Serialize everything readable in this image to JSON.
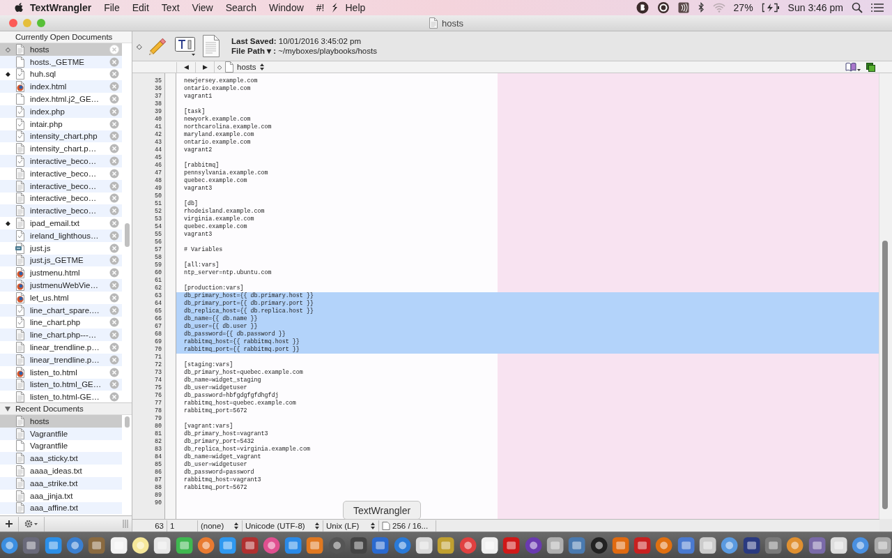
{
  "menubar": {
    "app": "TextWrangler",
    "menus": [
      "File",
      "Edit",
      "Text",
      "View",
      "Search",
      "Window",
      "#!"
    ],
    "help_menu": "Help",
    "battery": "27%",
    "clock": "Sun 3:46 pm"
  },
  "window": {
    "title": "hosts"
  },
  "sidebar": {
    "open_documents": {
      "title": "Currently Open Documents",
      "items": [
        {
          "name": "hosts",
          "kind": "text",
          "mark": "◇",
          "selected": true
        },
        {
          "name": "hosts._GETME",
          "kind": "blank",
          "selected": false
        },
        {
          "name": "huh.sql",
          "kind": "script",
          "mark": "◆",
          "selected": false
        },
        {
          "name": "index.html",
          "kind": "html",
          "selected": false
        },
        {
          "name": "index.html.j2_GE…",
          "kind": "blank",
          "selected": false
        },
        {
          "name": "index.php",
          "kind": "script",
          "selected": false
        },
        {
          "name": "intair.php",
          "kind": "script",
          "selected": false
        },
        {
          "name": "intensity_chart.php",
          "kind": "script",
          "selected": false
        },
        {
          "name": "intensity_chart.p…",
          "kind": "text",
          "selected": false
        },
        {
          "name": "interactive_beco…",
          "kind": "script",
          "selected": false
        },
        {
          "name": "interactive_beco…",
          "kind": "text",
          "selected": false
        },
        {
          "name": "interactive_beco…",
          "kind": "text",
          "selected": false
        },
        {
          "name": "interactive_beco…",
          "kind": "text",
          "selected": false
        },
        {
          "name": "interactive_beco…",
          "kind": "text",
          "selected": false
        },
        {
          "name": "ipad_email.txt",
          "kind": "text",
          "mark": "◆",
          "selected": false
        },
        {
          "name": "ireland_lighthous…",
          "kind": "script",
          "selected": false
        },
        {
          "name": "just.js",
          "kind": "js",
          "selected": false
        },
        {
          "name": "just.js_GETME",
          "kind": "text",
          "selected": false
        },
        {
          "name": "justmenu.html",
          "kind": "html",
          "selected": false
        },
        {
          "name": "justmenuWebVie…",
          "kind": "html",
          "selected": false
        },
        {
          "name": "let_us.html",
          "kind": "html",
          "selected": false
        },
        {
          "name": "line_chart_spare.…",
          "kind": "script",
          "selected": false
        },
        {
          "name": "line_chart.php",
          "kind": "script",
          "selected": false
        },
        {
          "name": "line_chart.php---…",
          "kind": "text",
          "selected": false
        },
        {
          "name": "linear_trendline.p…",
          "kind": "text",
          "selected": false
        },
        {
          "name": "linear_trendline.p…",
          "kind": "text",
          "selected": false
        },
        {
          "name": "listen_to.html",
          "kind": "html",
          "selected": false
        },
        {
          "name": "listen_to.html_GE…",
          "kind": "text",
          "selected": false
        },
        {
          "name": "listen_to.html-GE…",
          "kind": "text",
          "selected": false
        }
      ]
    },
    "recent_documents": {
      "title": "Recent Documents",
      "expanded": true,
      "items": [
        {
          "name": "hosts",
          "kind": "text",
          "selected": true
        },
        {
          "name": "Vagrantfile",
          "kind": "text",
          "selected": false
        },
        {
          "name": "Vagrantfile",
          "kind": "blank",
          "selected": false
        },
        {
          "name": "aaa_sticky.txt",
          "kind": "text",
          "selected": false
        },
        {
          "name": "aaaa_ideas.txt",
          "kind": "text",
          "selected": false
        },
        {
          "name": "aaa_strike.txt",
          "kind": "text",
          "selected": false
        },
        {
          "name": "aaa_jinja.txt",
          "kind": "text",
          "selected": false
        },
        {
          "name": "aaa_affine.txt",
          "kind": "text",
          "selected": false
        }
      ]
    }
  },
  "toolbar": {
    "mark": "◇",
    "last_saved": "**Last Saved:** 10/01/2016 3:45:02 pm",
    "file_path": "**File Path ▾ :** ~/myboxes/playbooks/hosts"
  },
  "navbar": {
    "prev": "◀",
    "next": "▶",
    "mark": "◇",
    "document": "hosts"
  },
  "editor": {
    "lines": [
      {
        "number": "35",
        "text": "newjersey.example.com",
        "selected": false
      },
      {
        "number": "36",
        "text": "ontario.example.com",
        "selected": false
      },
      {
        "number": "37",
        "text": "vagrant1",
        "selected": false
      },
      {
        "number": "38",
        "selected": false
      },
      {
        "number": "39",
        "text": "[task]",
        "selected": false
      },
      {
        "number": "40",
        "text": "newyork.example.com",
        "selected": false
      },
      {
        "number": "41",
        "text": "northcarolina.example.com",
        "selected": false
      },
      {
        "number": "42",
        "text": "maryland.example.com",
        "selected": false
      },
      {
        "number": "43",
        "text": "ontario.example.com",
        "selected": false
      },
      {
        "number": "44",
        "text": "vagrant2",
        "selected": false
      },
      {
        "number": "45",
        "selected": false
      },
      {
        "number": "46",
        "text": "[rabbitmq]",
        "selected": false
      },
      {
        "number": "47",
        "text": "pennsylvania.example.com",
        "selected": false
      },
      {
        "number": "48",
        "text": "quebec.example.com",
        "selected": false
      },
      {
        "number": "49",
        "text": "vagrant3",
        "selected": false
      },
      {
        "number": "50",
        "selected": false
      },
      {
        "number": "51",
        "text": "[db]",
        "selected": false
      },
      {
        "number": "52",
        "text": "rhodeisland.example.com",
        "selected": false
      },
      {
        "number": "53",
        "text": "virginia.example.com",
        "selected": false
      },
      {
        "number": "54",
        "text": "quebec.example.com",
        "selected": false
      },
      {
        "number": "55",
        "text": "vagrant3",
        "selected": false
      },
      {
        "number": "56",
        "selected": false
      },
      {
        "number": "57",
        "text": "# Variables",
        "selected": false
      },
      {
        "number": "58",
        "selected": false
      },
      {
        "number": "59",
        "text": "[all:vars]",
        "selected": false
      },
      {
        "number": "60",
        "text": "ntp_server=ntp.ubuntu.com",
        "selected": false
      },
      {
        "number": "61",
        "selected": false
      },
      {
        "number": "62",
        "text": "[production:vars]",
        "selected": false
      },
      {
        "number": "63",
        "text": "db_primary_host={{ db.primary.host }}",
        "selected": true
      },
      {
        "number": "64",
        "text": "db_primary_port={{ db.primary.port }}",
        "selected": true
      },
      {
        "number": "65",
        "text": "db_replica_host={{ db.replica.host }}",
        "selected": true
      },
      {
        "number": "66",
        "text": "db_name={{ db.name }}",
        "selected": true
      },
      {
        "number": "67",
        "text": "db_user={{ db.user }}",
        "selected": true
      },
      {
        "number": "68",
        "text": "db_password={{ db.password }}",
        "selected": true
      },
      {
        "number": "69",
        "text": "rabbitmq_host={{ rabbitmq.host }}",
        "selected": true
      },
      {
        "number": "70",
        "text": "rabbitmq_port={{ rabbitmq.port }}",
        "selected": true
      },
      {
        "number": "71",
        "selected": false
      },
      {
        "number": "72",
        "text": "[staging:vars]",
        "selected": false
      },
      {
        "number": "73",
        "text": "db_primary_host=quebec.example.com",
        "selected": false
      },
      {
        "number": "74",
        "text": "db_name=widget_staging",
        "selected": false
      },
      {
        "number": "75",
        "text": "db_user=widgetuser",
        "selected": false
      },
      {
        "number": "76",
        "text": "db_password=hbfgdgfgfdhgfdj",
        "selected": false
      },
      {
        "number": "77",
        "text": "rabbitmq_host=quebec.example.com",
        "selected": false
      },
      {
        "number": "78",
        "text": "rabbitmq_port=5672",
        "selected": false
      },
      {
        "number": "79",
        "selected": false
      },
      {
        "number": "80",
        "text": "[vagrant:vars]",
        "selected": false
      },
      {
        "number": "81",
        "text": "db_primary_host=vagrant3",
        "selected": false
      },
      {
        "number": "82",
        "text": "db_primary_port=5432",
        "selected": false
      },
      {
        "number": "83",
        "text": "db_replica_host=virginia.example.com",
        "selected": false
      },
      {
        "number": "84",
        "text": "db_name=widget_vagrant",
        "selected": false
      },
      {
        "number": "85",
        "text": "db_user=widgetuser",
        "selected": false
      },
      {
        "number": "86",
        "text": "db_password=password",
        "selected": false
      },
      {
        "number": "87",
        "text": "rabbitmq_host=vagrant3",
        "selected": false
      },
      {
        "number": "88",
        "text": "rabbitmq_port=5672",
        "selected": false
      },
      {
        "number": "89",
        "selected": false
      },
      {
        "number": "90",
        "selected": false
      }
    ]
  },
  "status_bar": {
    "line": "63",
    "column": "1",
    "language": "(none)",
    "encoding": "Unicode (UTF-8)",
    "line_endings": "Unix (LF)",
    "counts": "256 / 16..."
  },
  "dock": {
    "tooltip": "TextWrangler"
  }
}
